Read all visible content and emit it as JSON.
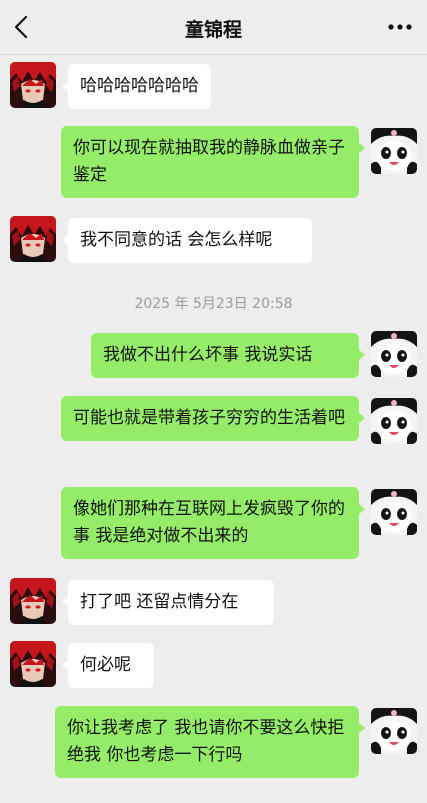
{
  "header": {
    "title": "童锦程",
    "back_icon": "chevron-left-icon",
    "more_icon": "more-dots-icon"
  },
  "colors": {
    "background": "#ededed",
    "incoming_bubble": "#ffffff",
    "outgoing_bubble": "#95ec69"
  },
  "messages": [
    {
      "side": "left",
      "text": "哈哈哈哈哈哈哈"
    },
    {
      "side": "right",
      "text": "你可以现在就抽取我的静脉血做亲子鉴定"
    },
    {
      "side": "left",
      "text": "我不同意的话 会怎么样呢"
    },
    {
      "type": "timestamp",
      "text": "2025 年 5月23日 20:58"
    },
    {
      "side": "right",
      "text": "我做不出什么坏事 我说实话"
    },
    {
      "side": "right",
      "text": "可能也就是带着孩子穷穷的生活着吧"
    },
    {
      "side": "right",
      "text": "像她们那种在互联网上发疯毁了你的事 我是绝对做不出来的"
    },
    {
      "side": "left",
      "text": "打了吧 还留点情分在"
    },
    {
      "side": "left",
      "text": "何必呢"
    },
    {
      "side": "right",
      "text": "你让我考虑了 我也请你不要这么快拒绝我 你也考虑一下行吗"
    }
  ]
}
